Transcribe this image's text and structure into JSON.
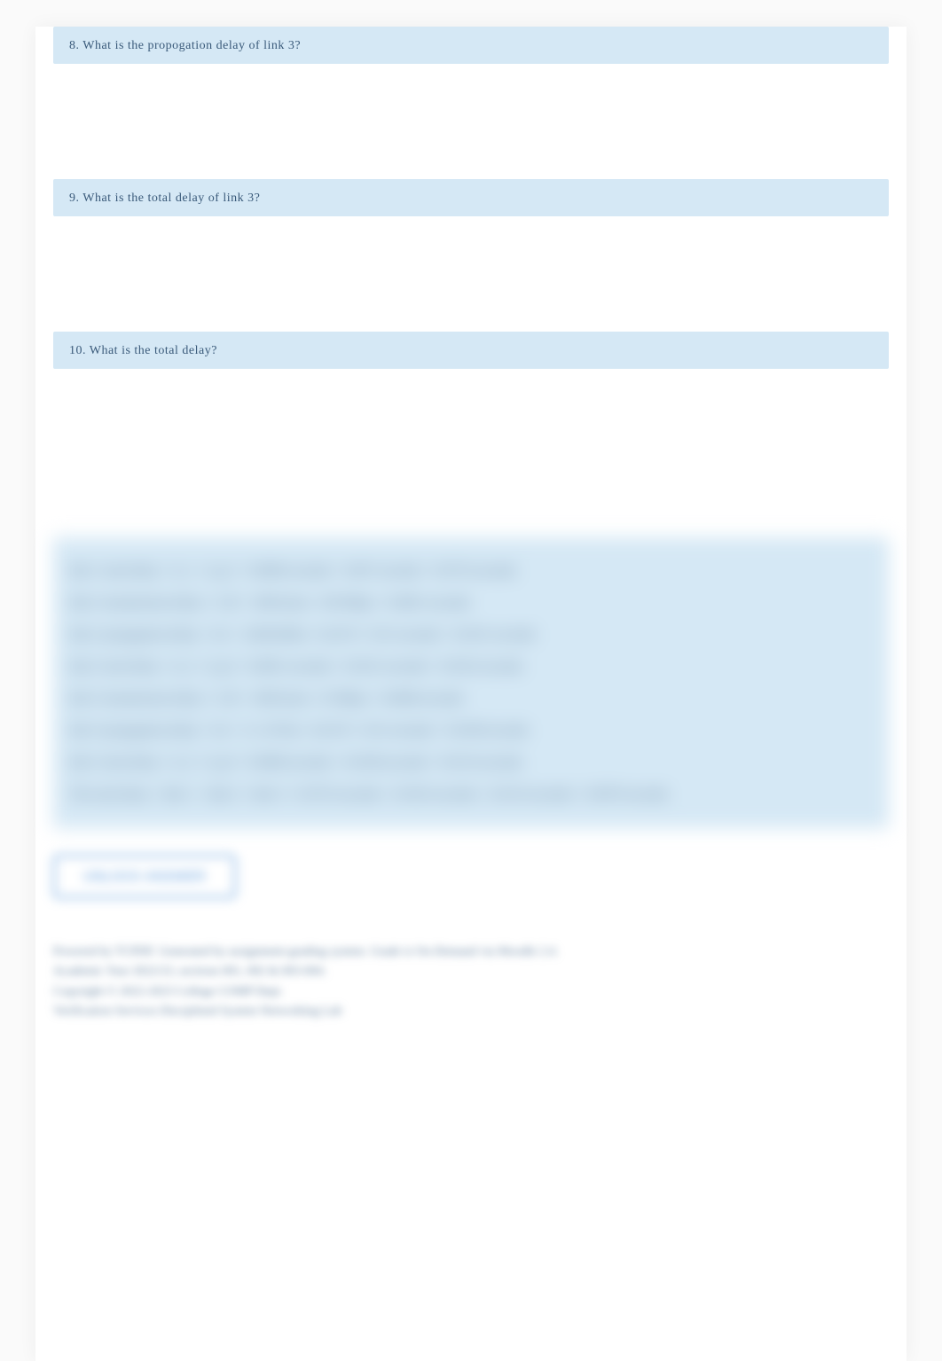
{
  "questions": [
    {
      "number": "8.",
      "text": "What is the propogation delay of link 3?"
    },
    {
      "number": "9.",
      "text": "What is the total delay of link 3?"
    },
    {
      "number": "10.",
      "text": "What is the total delay?"
    }
  ],
  "answers": [
    "link 1 total delay = d_1 + d_p1 = 0.0086 seconds + 0.067 seconds = 0.0753 seconds",
    "link 2 transmission delay = L/R = 1000 bytes / 100 Mbps = 0.0001 seconds",
    "link 2 propagation delay = d/s = 3,000,000m / 3x10^8 = 0.01 seconds = 0.0101 seconds",
    "link 2 total delay = d_2 + d_p2 = 0.0001 seconds + 0.0101 seconds = 0.0102 seconds",
    "link 3 transmission delay = L/R = 1000 bytes / 10 Mbps = 0.0008 seconds",
    "link 3 propagation delay = d/s = 3 x 10^6m / 3x10^8 = 0.01 seconds = 0.0108 seconds",
    "link 3 total delay = d_3 + d_p3 = 0.0008 seconds + 0.0108 seconds = 0.0116 seconds",
    "The total delay = link 1 + link 2 + link 3 = 0.0753 seconds + 0.0102 seconds + 0.0116 seconds = 0.0970 seconds"
  ],
  "unlock_button_label": "UNLOCK ANSWER",
  "footer": {
    "line1": "Powered by TCPDF. Generated by assignment-grading system. Grade is On-Demand via Moodle 2.4.",
    "line2": "Academic Year 2022/23, sections 001, 002 & 003-004.",
    "line3": "Copyright © 2022-2023 College COMP Dept.",
    "line4": "Verification Services Disciplined System Networking Lab"
  }
}
